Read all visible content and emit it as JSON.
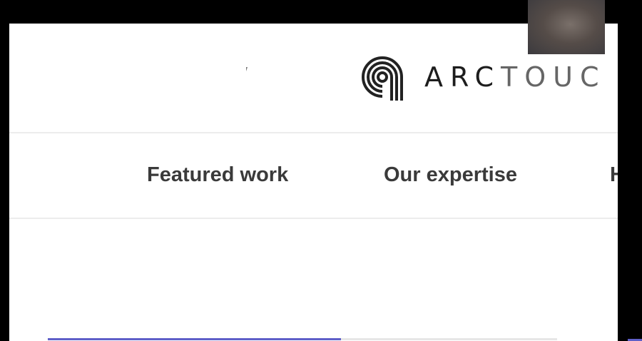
{
  "brand": {
    "name_light": "ARC",
    "name_dark": "TOUC",
    "logo_icon": "arctouch-swirl-icon"
  },
  "nav": {
    "items": [
      {
        "label": "Featured work"
      },
      {
        "label": "Our expertise"
      },
      {
        "label": "H"
      }
    ]
  },
  "progress": {
    "fraction": 0.575
  },
  "colors": {
    "accent": "#5f5fc8",
    "text": "#3a3a3a",
    "divider": "#ececec",
    "frame": "#000000"
  }
}
